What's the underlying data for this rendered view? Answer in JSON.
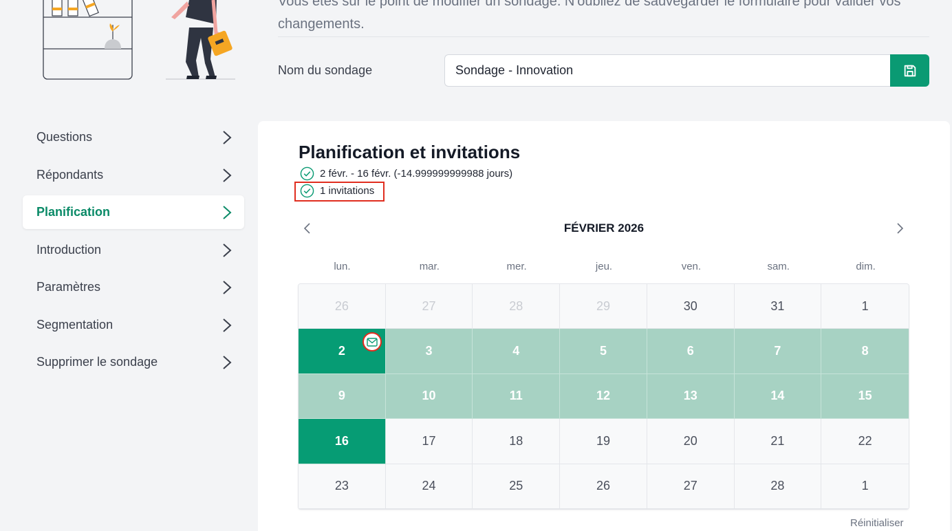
{
  "header": {
    "intro_text": "Vous êtes sur le point de modifier un sondage. N'oubliez de sauvegarder le formulaire pour valider vos changements.",
    "name_label": "Nom du sondage",
    "name_value": "Sondage - Innovation",
    "save_icon": "save-icon"
  },
  "sidebar": {
    "items": [
      {
        "label": "Questions"
      },
      {
        "label": "Répondants"
      },
      {
        "label": "Planification"
      },
      {
        "label": "Introduction"
      },
      {
        "label": "Paramètres"
      },
      {
        "label": "Segmentation"
      },
      {
        "label": "Supprimer le sondage"
      }
    ],
    "active_index": 2
  },
  "main": {
    "title": "Planification et invitations",
    "status": [
      {
        "text": "2 févr. - 16 févr. (-14.999999999988 jours)"
      },
      {
        "text": "1 invitations"
      }
    ]
  },
  "calendar": {
    "month": "FÉVRIER 2026",
    "weekdays": [
      "lun.",
      "mar.",
      "mer.",
      "jeu.",
      "ven.",
      "sam.",
      "dim."
    ],
    "days": [
      {
        "n": "26",
        "s": "out"
      },
      {
        "n": "27",
        "s": "out"
      },
      {
        "n": "28",
        "s": "out"
      },
      {
        "n": "29",
        "s": "out"
      },
      {
        "n": "30",
        "s": ""
      },
      {
        "n": "31",
        "s": ""
      },
      {
        "n": "1",
        "s": ""
      },
      {
        "n": "2",
        "s": "edge",
        "invite": true
      },
      {
        "n": "3",
        "s": "range"
      },
      {
        "n": "4",
        "s": "range"
      },
      {
        "n": "5",
        "s": "range"
      },
      {
        "n": "6",
        "s": "range"
      },
      {
        "n": "7",
        "s": "range"
      },
      {
        "n": "8",
        "s": "range"
      },
      {
        "n": "9",
        "s": "range"
      },
      {
        "n": "10",
        "s": "range"
      },
      {
        "n": "11",
        "s": "range"
      },
      {
        "n": "12",
        "s": "range"
      },
      {
        "n": "13",
        "s": "range"
      },
      {
        "n": "14",
        "s": "range"
      },
      {
        "n": "15",
        "s": "range"
      },
      {
        "n": "16",
        "s": "edge"
      },
      {
        "n": "17",
        "s": ""
      },
      {
        "n": "18",
        "s": ""
      },
      {
        "n": "19",
        "s": ""
      },
      {
        "n": "20",
        "s": ""
      },
      {
        "n": "21",
        "s": ""
      },
      {
        "n": "22",
        "s": ""
      },
      {
        "n": "23",
        "s": ""
      },
      {
        "n": "24",
        "s": ""
      },
      {
        "n": "25",
        "s": ""
      },
      {
        "n": "26",
        "s": ""
      },
      {
        "n": "27",
        "s": ""
      },
      {
        "n": "28",
        "s": ""
      },
      {
        "n": "1",
        "s": ""
      }
    ],
    "reset_label": "Réinitialiser"
  },
  "colors": {
    "accent": "#0a9a73",
    "range": "#a7d2c3",
    "highlight": "#e02d1f"
  }
}
